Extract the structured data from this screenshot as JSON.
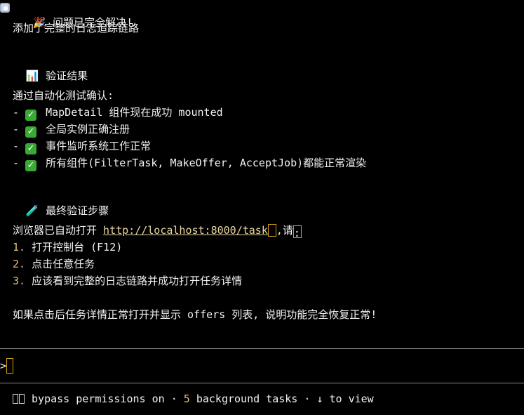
{
  "header": {
    "emoji": "🎉",
    "title": "问题已完全解决!"
  },
  "intro_line": "添加了完整的日志追踪链路",
  "verify_section": {
    "emoji": "📊",
    "heading": "验证结果",
    "lead": "通过自动化测试确认:",
    "items": [
      "MapDetail 组件现在成功 mounted",
      "全局实例正确注册",
      "事件监听系统工作正常",
      "所有组件(FilterTask, MakeOffer, AcceptJob)都能正常渲染"
    ]
  },
  "final_section": {
    "emoji": "🧪",
    "heading": "最终验证步骤",
    "lead_prefix": "浏览器已自动打开 ",
    "lead_url": "http://localhost:8000/task",
    "lead_sep": ",",
    "lead_please": "请",
    "lead_colon": ":",
    "steps": [
      {
        "num": "1.",
        "text": "打开控制台 (F12)"
      },
      {
        "num": "2.",
        "text": "点击任意任务"
      },
      {
        "num": "3.",
        "text": "应该看到完整的日志链路并成功打开任务详情"
      }
    ]
  },
  "conclusion": "如果点击后任务详情正常打开并显示 offers 列表, 说明功能完全恢复正常!",
  "prompt": {
    "symbol": ">"
  },
  "footer": {
    "mode": "bypass permissions on",
    "sep1": " · ",
    "count": "5",
    "tasks_label": " background tasks",
    "sep2": " · ",
    "view_hint": "↓ to view"
  },
  "colors": {
    "background": "#000000",
    "text": "#f2f2f2",
    "accent": "#e5c07b",
    "check": "#3aa935",
    "cursor_border": "#d4a017"
  }
}
